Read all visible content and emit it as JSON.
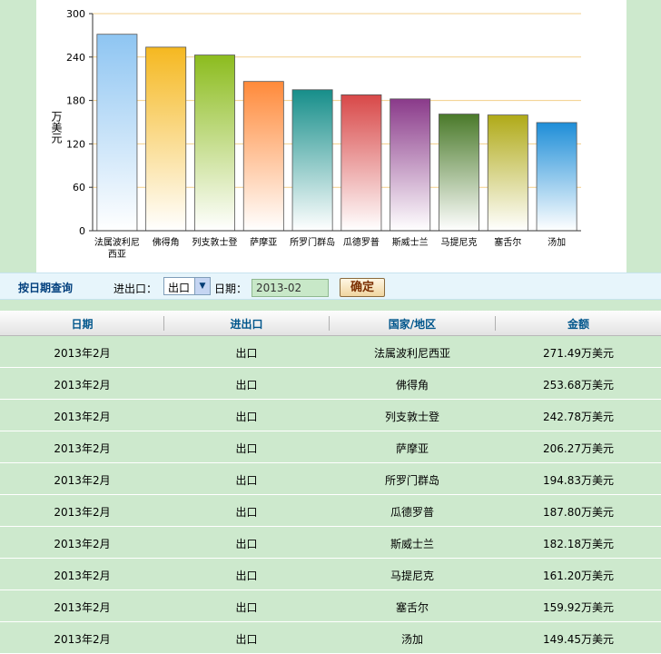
{
  "chart_data": {
    "type": "bar",
    "ylabel": "万美元",
    "ylim": [
      0,
      300
    ],
    "yticks": [
      0,
      60,
      120,
      180,
      240,
      300
    ],
    "categories": [
      "法属波利尼西亚",
      "佛得角",
      "列支敦士登",
      "萨摩亚",
      "所罗门群岛",
      "瓜德罗普",
      "斯威士兰",
      "马提尼克",
      "塞舌尔",
      "汤加"
    ],
    "values": [
      271.49,
      253.68,
      242.78,
      206.27,
      194.83,
      187.8,
      182.18,
      161.2,
      159.92,
      149.45
    ],
    "colors": [
      "#8ec5f2",
      "#f5b820",
      "#8cbc1e",
      "#ff8a3a",
      "#168e8a",
      "#d84848",
      "#8a3a8a",
      "#4a7a2a",
      "#b0aa18",
      "#1e8ed8"
    ],
    "grid": true
  },
  "query": {
    "title": "按日期查询",
    "type_label": "进出口：",
    "type_value": "出口",
    "date_label": "日期：",
    "date_value": "2013-02",
    "confirm_label": "确定"
  },
  "table": {
    "headers": [
      "日期",
      "进出口",
      "国家/地区",
      "金额"
    ],
    "rows": [
      [
        "2013年2月",
        "出口",
        "法属波利尼西亚",
        "271.49万美元"
      ],
      [
        "2013年2月",
        "出口",
        "佛得角",
        "253.68万美元"
      ],
      [
        "2013年2月",
        "出口",
        "列支敦士登",
        "242.78万美元"
      ],
      [
        "2013年2月",
        "出口",
        "萨摩亚",
        "206.27万美元"
      ],
      [
        "2013年2月",
        "出口",
        "所罗门群岛",
        "194.83万美元"
      ],
      [
        "2013年2月",
        "出口",
        "瓜德罗普",
        "187.80万美元"
      ],
      [
        "2013年2月",
        "出口",
        "斯威士兰",
        "182.18万美元"
      ],
      [
        "2013年2月",
        "出口",
        "马提尼克",
        "161.20万美元"
      ],
      [
        "2013年2月",
        "出口",
        "塞舌尔",
        "159.92万美元"
      ],
      [
        "2013年2月",
        "出口",
        "汤加",
        "149.45万美元"
      ]
    ]
  }
}
